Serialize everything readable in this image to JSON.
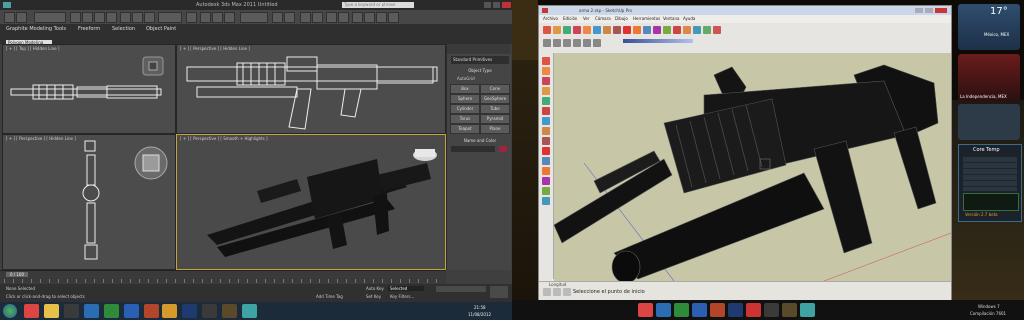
{
  "left_app": {
    "title": "Autodesk 3ds Max 2011     Untitled",
    "search_placeholder": "Type a keyword or phrase",
    "ribbon_tabs": [
      "Graphite Modeling Tools",
      "Freeform",
      "Selection",
      "Object Paint"
    ],
    "ribbon_sub": "Polygon Modeling",
    "viewports": [
      {
        "label": "[ + ] [ Top ] [ Hidden Line ]"
      },
      {
        "label": "[ + ] [ Perspective ] [ Hidden Line ]"
      },
      {
        "label": "[ + ] [ Perspective ] [ Hidden Line ]"
      },
      {
        "label": "[ + ] [ Perspective ] [ Smooth + Highlights ]"
      }
    ],
    "command_panel": {
      "dropdown": "Standard Primitives",
      "section_object_type": "Object Type",
      "autogrid": "AutoGrid",
      "buttons": [
        "Box",
        "Cone",
        "Sphere",
        "GeoSphere",
        "Cylinder",
        "Tube",
        "Torus",
        "Pyramid",
        "Teapot",
        "Plane"
      ],
      "section_name_color": "Name and Color"
    },
    "timeline": {
      "frame": "0 / 100"
    },
    "status": {
      "none_selected": "None Selected",
      "hint": "Click or click-and-drag to select objects",
      "autokey": "Auto Key",
      "set_key": "Set Key",
      "selected": "Selected",
      "key_filters": "Key Filters...",
      "add_time_tag": "Add Time Tag"
    }
  },
  "left_taskbar": {
    "time": "21:58",
    "date": "11/08/2012"
  },
  "right_app": {
    "title": "arma 2.skp - SketchUp Pro",
    "menu": [
      "Archivo",
      "Edición",
      "Ver",
      "Cámara",
      "Dibujo",
      "Herramientas",
      "Ventana",
      "Ayuda"
    ],
    "status_label": "Longitud",
    "status_hint": "Seleccione el punto de inicio"
  },
  "gadgets": {
    "weather1": {
      "temp": "17°",
      "city": "México, MEX"
    },
    "weather2": {
      "city": "La Independencia, MEX"
    },
    "core_temp": {
      "title": "Core Temp",
      "version_label": "Versión 2.7 beta"
    }
  },
  "right_taskbar": {
    "os": "Windows 7",
    "build": "Compilación 7601"
  },
  "colors": {
    "max_bg": "#3f3f3f",
    "viewport_bg": "#4c4c4c",
    "selected_border": "#c8a23a",
    "sketchup_canvas": "#c7c7a8",
    "taskbar": "#1c2b3a"
  }
}
